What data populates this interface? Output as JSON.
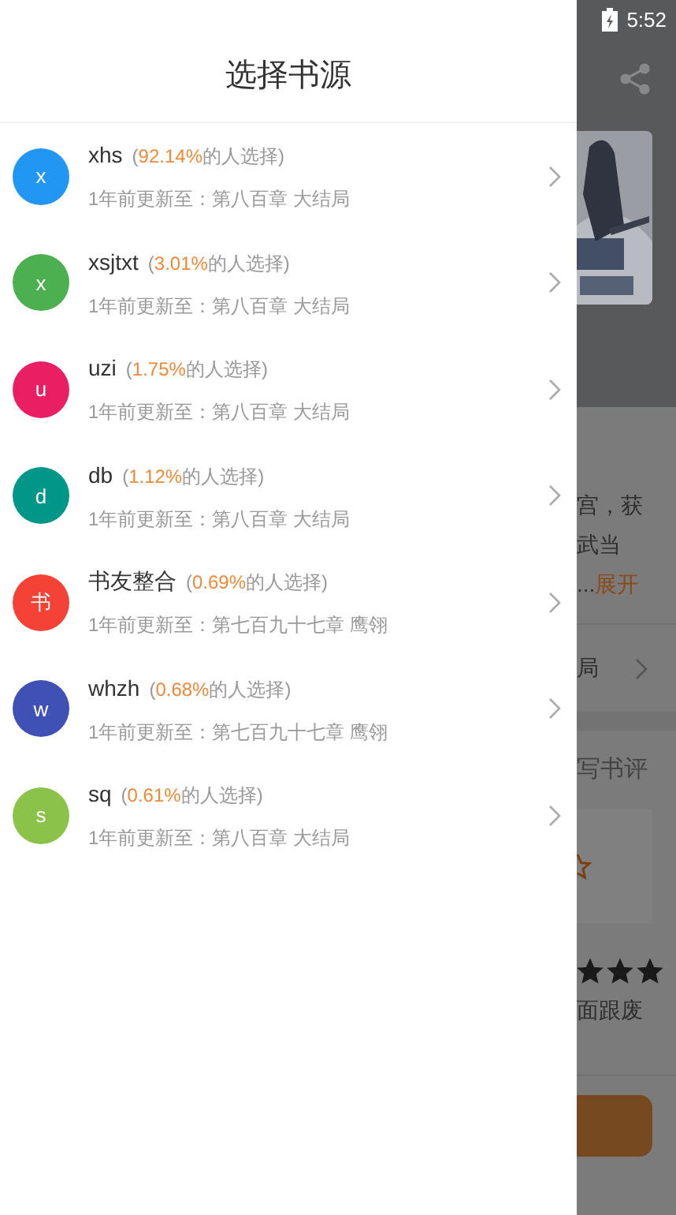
{
  "status_bar": {
    "time": "5:52"
  },
  "sheet": {
    "title": "选择书源",
    "sources": [
      {
        "avatar": "x",
        "color": "#2196f3",
        "name": "xhs",
        "share_before": "(",
        "share": "92.14%",
        "share_after": "的人选择)",
        "update": "1年前更新至：第八百章 大结局"
      },
      {
        "avatar": "x",
        "color": "#4caf50",
        "name": "xsjtxt",
        "share_before": "(",
        "share": "3.01%",
        "share_after": "的人选择)",
        "update": "1年前更新至：第八百章 大结局"
      },
      {
        "avatar": "u",
        "color": "#e91e63",
        "name": "uzi",
        "share_before": "(",
        "share": "1.75%",
        "share_after": "的人选择)",
        "update": "1年前更新至：第八百章 大结局"
      },
      {
        "avatar": "d",
        "color": "#009688",
        "name": "db",
        "share_before": "(",
        "share": "1.12%",
        "share_after": "的人选择)",
        "update": "1年前更新至：第八百章 大结局"
      },
      {
        "avatar": "书",
        "color": "#f44336",
        "name": "书友整合",
        "share_before": "(",
        "share": "0.69%",
        "share_after": "的人选择)",
        "update": "1年前更新至：第七百九十七章 鹰翎"
      },
      {
        "avatar": "w",
        "color": "#3f51b5",
        "name": "whzh",
        "share_before": "(",
        "share": "0.68%",
        "share_after": "的人选择)",
        "update": "1年前更新至：第七百九十七章 鹰翎"
      },
      {
        "avatar": "s",
        "color": "#8bc34a",
        "name": "sq",
        "share_before": "(",
        "share": "0.61%",
        "share_after": "的人选择)",
        "update": "1年前更新至：第八百章 大结局"
      }
    ]
  },
  "background": {
    "intro_lines": [
      "宫，获",
      "武当"
    ],
    "expand_prefix": "...",
    "expand": "展开",
    "latest": "局",
    "review": "写书评",
    "stars": 3,
    "note": "面跟废"
  }
}
